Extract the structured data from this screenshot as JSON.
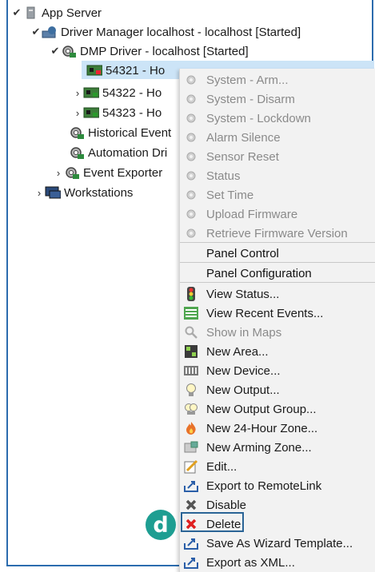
{
  "colors": {
    "frame_border": "#2c6cae",
    "selection": "#cce4f7",
    "menu_bg": "#f2f2f2",
    "badge": "#1e9e92",
    "delete_highlight": "#2a6496"
  },
  "tree": {
    "app_server": "App Server",
    "driver_manager": "Driver Manager localhost - localhost [Started]",
    "dmp_driver": "DMP Driver - localhost [Started]",
    "panel_54321": "54321 - Ho",
    "panel_54322": "54322 - Ho",
    "panel_54323": "54323 - Ho",
    "historical_event": "Historical Event",
    "automation_driver": "Automation Dri",
    "event_exporter": "Event Exporter",
    "workstations": "Workstations"
  },
  "context_menu": {
    "items": [
      {
        "label": "System - Arm...",
        "icon": "gear-icon",
        "enabled": false
      },
      {
        "label": "System - Disarm",
        "icon": "gear-icon",
        "enabled": false
      },
      {
        "label": "System - Lockdown",
        "icon": "gear-icon",
        "enabled": false
      },
      {
        "label": "Alarm Silence",
        "icon": "gear-icon",
        "enabled": false
      },
      {
        "label": "Sensor Reset",
        "icon": "gear-icon",
        "enabled": false
      },
      {
        "label": "Status",
        "icon": "gear-icon",
        "enabled": false
      },
      {
        "label": "Set Time",
        "icon": "gear-icon",
        "enabled": false
      },
      {
        "label": "Upload Firmware",
        "icon": "gear-icon",
        "enabled": false
      },
      {
        "label": "Retrieve Firmware Version",
        "icon": "gear-icon",
        "enabled": false
      },
      {
        "label": "Panel Control",
        "icon": "",
        "enabled": true
      },
      {
        "label": "Panel Configuration",
        "icon": "",
        "enabled": true
      },
      {
        "label": "View Status...",
        "icon": "traffic-light-icon",
        "enabled": true
      },
      {
        "label": "View Recent Events...",
        "icon": "list-icon",
        "enabled": true
      },
      {
        "label": "Show in Maps",
        "icon": "magnifier-icon",
        "enabled": false
      },
      {
        "label": "New Area...",
        "icon": "area-icon",
        "enabled": true
      },
      {
        "label": "New Device...",
        "icon": "device-icon",
        "enabled": true
      },
      {
        "label": "New Output...",
        "icon": "lightbulb-icon",
        "enabled": true
      },
      {
        "label": "New Output Group...",
        "icon": "lightbulb-group-icon",
        "enabled": true
      },
      {
        "label": "New 24-Hour Zone...",
        "icon": "flame-icon",
        "enabled": true
      },
      {
        "label": "New Arming Zone...",
        "icon": "arming-zone-icon",
        "enabled": true
      },
      {
        "label": "Edit...",
        "icon": "edit-icon",
        "enabled": true
      },
      {
        "label": "Export to RemoteLink",
        "icon": "export-icon",
        "enabled": true
      },
      {
        "label": "Disable",
        "icon": "disable-x-icon",
        "enabled": true
      },
      {
        "label": "Delete",
        "icon": "delete-x-icon",
        "enabled": true
      },
      {
        "label": "Save As Wizard Template...",
        "icon": "export-icon",
        "enabled": true
      },
      {
        "label": "Export as XML...",
        "icon": "export-icon",
        "enabled": true
      }
    ]
  },
  "callout": {
    "letter": "d"
  }
}
